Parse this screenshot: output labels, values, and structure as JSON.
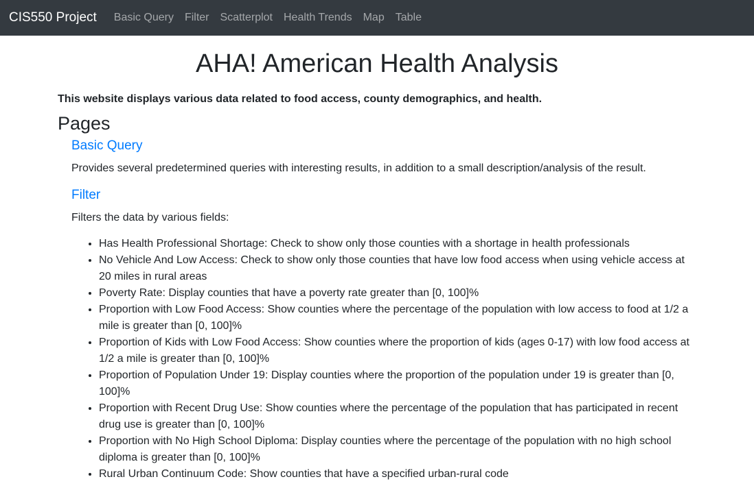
{
  "nav": {
    "brand": "CIS550 Project",
    "links": [
      "Basic Query",
      "Filter",
      "Scatterplot",
      "Health Trends",
      "Map",
      "Table"
    ]
  },
  "main": {
    "title": "AHA! American Health Analysis",
    "intro": "This website displays various data related to food access, county demographics, and health.",
    "pages_heading": "Pages",
    "sections": [
      {
        "heading": "Basic Query",
        "description": "Provides several predetermined queries with interesting results, in addition to a small description/analysis of the result."
      },
      {
        "heading": "Filter",
        "description": "Filters the data by various fields:",
        "items": [
          "Has Health Professional Shortage: Check to show only those counties with a shortage in health professionals",
          "No Vehicle And Low Access: Check to show only those counties that have low food access when using vehicle access at 20 miles in rural areas",
          "Poverty Rate: Display counties that have a poverty rate greater than [0, 100]%",
          "Proportion with Low Food Access: Show counties where the percentage of the population with low access to food at 1/2 a mile is greater than [0, 100]%",
          "Proportion of Kids with Low Food Access: Show counties where the proportion of kids (ages 0-17) with low food access at 1/2 a mile is greater than [0, 100]%",
          "Proportion of Population Under 19: Display counties where the proportion of the population under 19 is greater than [0, 100]%",
          "Proportion with Recent Drug Use: Show counties where the percentage of the population that has participated in recent drug use is greater than [0, 100]%",
          "Proportion with No High School Diploma: Display counties where the percentage of the population with no high school diploma is greater than [0, 100]%",
          "Rural Urban Continuum Code: Show counties that have a specified urban-rural code"
        ]
      }
    ]
  }
}
